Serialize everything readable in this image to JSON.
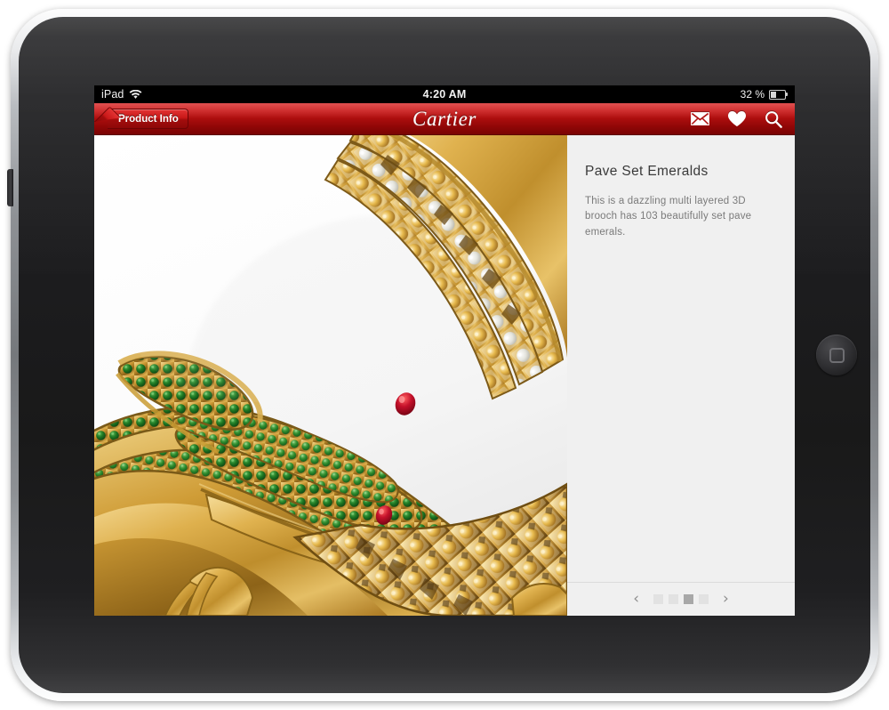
{
  "device": {
    "name": "iPad",
    "home_button_icon": "home-rounded-square-icon",
    "side_button_icon": "power-button"
  },
  "statusbar": {
    "carrier": "iPad",
    "wifi_icon": "wifi-icon",
    "time": "4:20 AM",
    "battery_text": "32 %",
    "battery_icon": "battery-icon"
  },
  "navbar": {
    "back_label": "Product Info",
    "brand": "Cartier",
    "actions": [
      {
        "name": "mail-icon",
        "label": "Mail"
      },
      {
        "name": "heart-icon",
        "label": "Favorites"
      },
      {
        "name": "search-icon",
        "label": "Search"
      }
    ],
    "colors": {
      "red_top": "#d81f1f",
      "red_bottom": "#7a0303"
    }
  },
  "product": {
    "image_alt": "Gold crocodile brooch pave set with emeralds and yellow diamonds",
    "title": "Pave Set Emeralds",
    "description": "This is a dazzling multi layered 3D brooch has 103 beautifully set pave emerals.",
    "gem_count": "103"
  },
  "pager": {
    "prev_icon": "chevron-left-icon",
    "next_icon": "chevron-right-icon",
    "prev_label": "‹",
    "next_label": "›",
    "total": 4,
    "active_index": 3,
    "dots": [
      {
        "active": false
      },
      {
        "active": false
      },
      {
        "active": true
      },
      {
        "active": false
      }
    ]
  }
}
